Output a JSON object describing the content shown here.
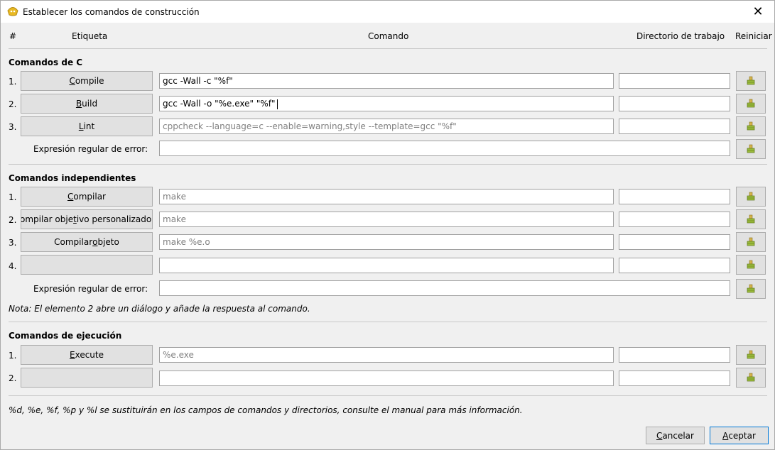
{
  "window": {
    "title": "Establecer los comandos de construcción",
    "close_label": "✕"
  },
  "columns": {
    "number": "#",
    "label": "Etiqueta",
    "command": "Comando",
    "working_dir": "Directorio de trabajo",
    "reset": "Reiniciar"
  },
  "c_commands": {
    "title": "Comandos de C",
    "rows": [
      {
        "num": "1.",
        "label_pre": "",
        "label_mn": "C",
        "label_post": "ompile",
        "command": "gcc -Wall -c \"%f\"",
        "command_is_placeholder": false,
        "dir": ""
      },
      {
        "num": "2.",
        "label_pre": "",
        "label_mn": "B",
        "label_post": "uild",
        "command": "gcc -Wall -o \"%e.exe\" \"%f\"",
        "command_is_placeholder": false,
        "dir": ""
      },
      {
        "num": "3.",
        "label_pre": "",
        "label_mn": "L",
        "label_post": "int",
        "command": "cppcheck --language=c --enable=warning,style --template=gcc \"%f\"",
        "command_is_placeholder": true,
        "dir": ""
      }
    ],
    "regex_label": "Expresión regular de error:",
    "regex_value": ""
  },
  "independent_commands": {
    "title": "Comandos independientes",
    "rows": [
      {
        "num": "1.",
        "label_pre": "",
        "label_mn": "C",
        "label_post": "ompilar",
        "command": "make",
        "command_is_placeholder": true,
        "dir": ""
      },
      {
        "num": "2.",
        "label_pre": "Compilar obje",
        "label_mn": "t",
        "label_post": "ivo personalizado...",
        "command": "make",
        "command_is_placeholder": true,
        "dir": ""
      },
      {
        "num": "3.",
        "label_pre": "Compilar ",
        "label_mn": "o",
        "label_post": "bjeto",
        "command": "make %e.o",
        "command_is_placeholder": true,
        "dir": ""
      },
      {
        "num": "4.",
        "label_pre": "",
        "label_mn": "",
        "label_post": "",
        "command": "",
        "command_is_placeholder": false,
        "dir": ""
      }
    ],
    "regex_label": "Expresión regular de error:",
    "regex_value": "",
    "note": "Nota: El elemento 2 abre un diálogo y añade la respuesta al comando."
  },
  "exec_commands": {
    "title": "Comandos de ejecución",
    "rows": [
      {
        "num": "1.",
        "label_pre": "",
        "label_mn": "E",
        "label_post": "xecute",
        "command": "%e.exe",
        "command_is_placeholder": true,
        "dir": ""
      },
      {
        "num": "2.",
        "label_pre": "",
        "label_mn": "",
        "label_post": "",
        "command": "",
        "command_is_placeholder": false,
        "dir": ""
      }
    ]
  },
  "footer_info": "%d, %e, %f, %p y %l se sustituirán en los campos de comandos y directorios, consulte el manual para más información.",
  "buttons": {
    "cancel_mn": "C",
    "cancel_rest": "ancelar",
    "accept_mn": "A",
    "accept_rest": "ceptar"
  },
  "colors": {
    "reset_icon_body": "#9bbb3b",
    "reset_icon_accent": "#d4b24a",
    "accept_border": "#0078d7"
  },
  "icons": {
    "title": "geany-icon",
    "reset": "clear-broom-icon"
  }
}
